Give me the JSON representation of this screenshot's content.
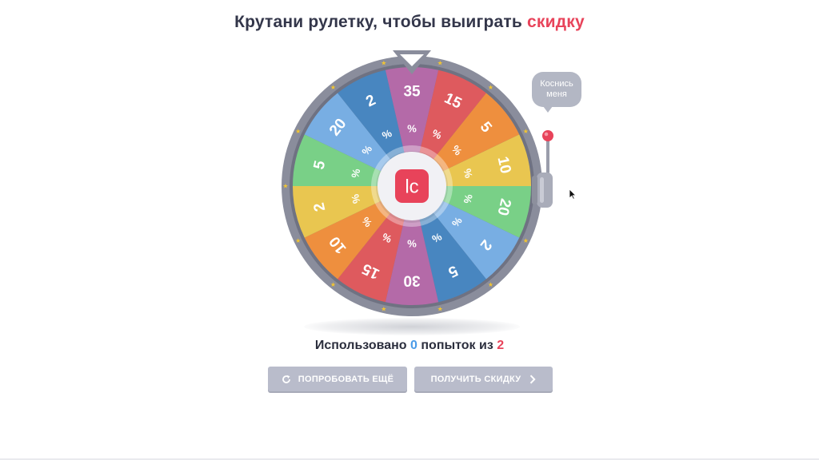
{
  "header": {
    "title_prefix": "Крутани рулетку, чтобы выиграть",
    "title_accent": "скидку"
  },
  "wheel": {
    "center_logo": "lc",
    "percent_sign": "%",
    "segments": [
      {
        "value": "35",
        "color": "#b46aa8"
      },
      {
        "value": "15",
        "color": "#de5a5e"
      },
      {
        "value": "5",
        "color": "#ee8f3e"
      },
      {
        "value": "10",
        "color": "#e9c650"
      },
      {
        "value": "20",
        "color": "#79d087"
      },
      {
        "value": "2",
        "color": "#78aee3"
      },
      {
        "value": "5",
        "color": "#4886c0"
      },
      {
        "value": "30",
        "color": "#b46aa8"
      },
      {
        "value": "15",
        "color": "#de5a5e"
      },
      {
        "value": "10",
        "color": "#ee8f3e"
      },
      {
        "value": "2",
        "color": "#e9c650"
      },
      {
        "value": "5",
        "color": "#79d087"
      },
      {
        "value": "20",
        "color": "#78aee3"
      },
      {
        "value": "2",
        "color": "#4886c0"
      }
    ],
    "rim_color": "#8a8d9c",
    "star_color": "#f2c531"
  },
  "lever": {
    "tooltip": "Коснись меня",
    "knob_color": "#e8435a"
  },
  "attempts": {
    "prefix": "Использовано",
    "used": "0",
    "middle": "попыток из",
    "total": "2"
  },
  "buttons": {
    "retry_label": "ПОПРОБОВАТЬ ЕЩЁ",
    "claim_label": "ПОЛУЧИТЬ СКИДКУ"
  }
}
